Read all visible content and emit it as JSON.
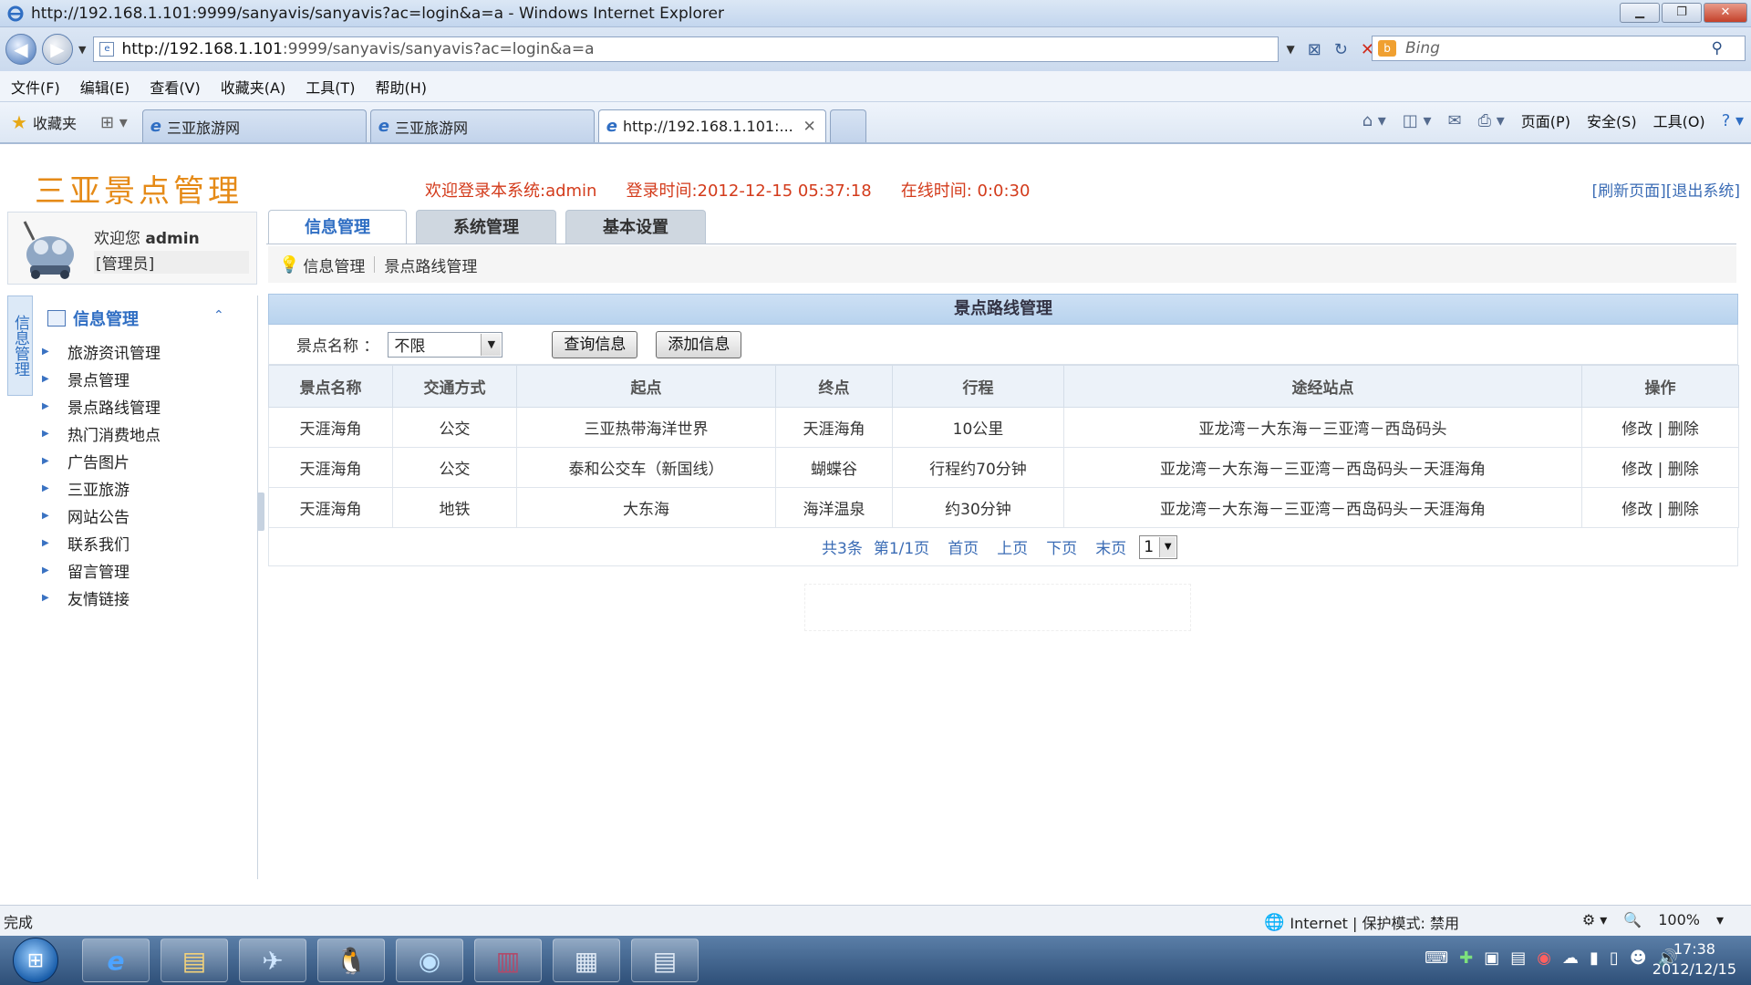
{
  "browser": {
    "window_title": "http://192.168.1.101:9999/sanyavis/sanyavis?ac=login&a=a - Windows Internet Explorer",
    "url_host": "http://192.168.1.101",
    "url_rest": ":9999/sanyavis/sanyavis?ac=login&a=a",
    "search_placeholder": "Bing",
    "menu": [
      "文件(F)",
      "编辑(E)",
      "查看(V)",
      "收藏夹(A)",
      "工具(T)",
      "帮助(H)"
    ],
    "favorites_label": "收藏夹",
    "tabs": [
      {
        "label": "三亚旅游网"
      },
      {
        "label": "三亚旅游网"
      },
      {
        "label": "http://192.168.1.101:..."
      }
    ],
    "cmd": {
      "page": "页面(P)",
      "safety": "安全(S)",
      "tools": "工具(O)"
    },
    "status_text": "完成",
    "status_zone": "Internet | 保护模式: 禁用",
    "zoom": "100%"
  },
  "site": {
    "title": "三亚景点管理",
    "welcome_line": "欢迎登录本系统:admin",
    "login_time": "登录时间:2012-12-15 05:37:18",
    "online_time": "在线时间: 0:0:30",
    "refresh_link": "[刷新页面]",
    "logout_link": "[退出系统]"
  },
  "user": {
    "greeting": "欢迎您",
    "name": "admin",
    "role": "[管理员]"
  },
  "sidebar": {
    "strip_label": "信息管理",
    "header": "信息管理",
    "items": [
      {
        "label": "旅游资讯管理"
      },
      {
        "label": "景点管理"
      },
      {
        "label": "景点路线管理"
      },
      {
        "label": "热门消费地点"
      },
      {
        "label": "广告图片"
      },
      {
        "label": "三亚旅游"
      },
      {
        "label": "网站公告"
      },
      {
        "label": "联系我们"
      },
      {
        "label": "留言管理"
      },
      {
        "label": "友情链接"
      }
    ]
  },
  "main_tabs": [
    {
      "label": "信息管理"
    },
    {
      "label": "系统管理"
    },
    {
      "label": "基本设置"
    }
  ],
  "breadcrumb": [
    "信息管理",
    "景点路线管理"
  ],
  "panel": {
    "title": "景点路线管理",
    "filter_label": "景点名称 ：",
    "filter_value": "不限",
    "query_button": "查询信息",
    "add_button": "添加信息"
  },
  "table": {
    "columns": [
      "景点名称",
      "交通方式",
      "起点",
      "终点",
      "行程",
      "途经站点",
      "操作"
    ],
    "rows": [
      {
        "name": "天涯海角",
        "transport": "公交",
        "start": "三亚热带海洋世界",
        "end": "天涯海角",
        "trip": "10公里",
        "stops": "亚龙湾－大东海－三亚湾－西岛码头"
      },
      {
        "name": "天涯海角",
        "transport": "公交",
        "start": "泰和公交车（新国线）",
        "end": "蝴蝶谷",
        "trip": "行程约70分钟",
        "stops": "亚龙湾－大东海－三亚湾－西岛码头－天涯海角"
      },
      {
        "name": "天涯海角",
        "transport": "地铁",
        "start": "大东海",
        "end": "海洋温泉",
        "trip": "约30分钟",
        "stops": "亚龙湾－大东海－三亚湾－西岛码头－天涯海角"
      }
    ],
    "edit_label": "修改",
    "delete_label": "删除",
    "action_sep": "|"
  },
  "pager": {
    "total": "共3条",
    "page_info": "第1/1页",
    "first": "首页",
    "prev": "上页",
    "next": "下页",
    "last": "末页",
    "page_select": "1"
  },
  "taskbar": {
    "time": "17:38",
    "date": "2012/12/15"
  }
}
